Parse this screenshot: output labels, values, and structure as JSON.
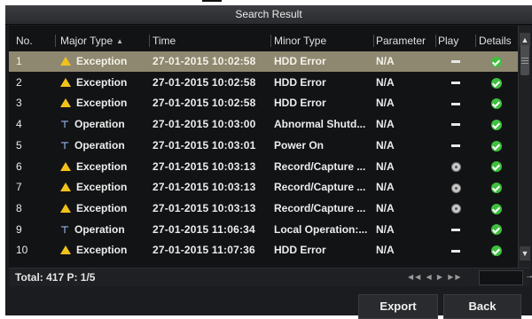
{
  "dialog": {
    "title": "Search Result"
  },
  "columns": {
    "no": "No.",
    "major": "Major Type",
    "time": "Time",
    "minor": "Minor Type",
    "param": "Parameter",
    "play": "Play",
    "details": "Details"
  },
  "rows": [
    {
      "no": "1",
      "major": "Exception",
      "major_icon": "warning-icon",
      "time": "27-01-2015 10:02:58",
      "minor": "HDD Error",
      "param": "N/A",
      "play": "dash",
      "selected": true
    },
    {
      "no": "2",
      "major": "Exception",
      "major_icon": "warning-icon",
      "time": "27-01-2015 10:02:58",
      "minor": "HDD Error",
      "param": "N/A",
      "play": "dash"
    },
    {
      "no": "3",
      "major": "Exception",
      "major_icon": "warning-icon",
      "time": "27-01-2015 10:02:58",
      "minor": "HDD Error",
      "param": "N/A",
      "play": "dash"
    },
    {
      "no": "4",
      "major": "Operation",
      "major_icon": "operation-icon",
      "time": "27-01-2015 10:03:00",
      "minor": "Abnormal Shutd...",
      "param": "N/A",
      "play": "dash"
    },
    {
      "no": "5",
      "major": "Operation",
      "major_icon": "operation-icon",
      "time": "27-01-2015 10:03:01",
      "minor": "Power On",
      "param": "N/A",
      "play": "dash"
    },
    {
      "no": "6",
      "major": "Exception",
      "major_icon": "warning-icon",
      "time": "27-01-2015 10:03:13",
      "minor": "Record/Capture ...",
      "param": "N/A",
      "play": "play-icon"
    },
    {
      "no": "7",
      "major": "Exception",
      "major_icon": "warning-icon",
      "time": "27-01-2015 10:03:13",
      "minor": "Record/Capture ...",
      "param": "N/A",
      "play": "play-icon"
    },
    {
      "no": "8",
      "major": "Exception",
      "major_icon": "warning-icon",
      "time": "27-01-2015 10:03:13",
      "minor": "Record/Capture ...",
      "param": "N/A",
      "play": "play-icon"
    },
    {
      "no": "9",
      "major": "Operation",
      "major_icon": "operation-icon",
      "time": "27-01-2015 11:06:34",
      "minor": "Local Operation:...",
      "param": "N/A",
      "play": "dash"
    },
    {
      "no": "10",
      "major": "Exception",
      "major_icon": "warning-icon",
      "time": "27-01-2015 11:07:36",
      "minor": "HDD Error",
      "param": "N/A",
      "play": "dash"
    }
  ],
  "footer": {
    "total": "Total: 417  P: 1/5"
  },
  "buttons": {
    "export": "Export",
    "back": "Back"
  },
  "colors": {
    "selected_row": "#8e8870",
    "warning": "#f2c21b",
    "details_ok": "#3fbf3f"
  }
}
